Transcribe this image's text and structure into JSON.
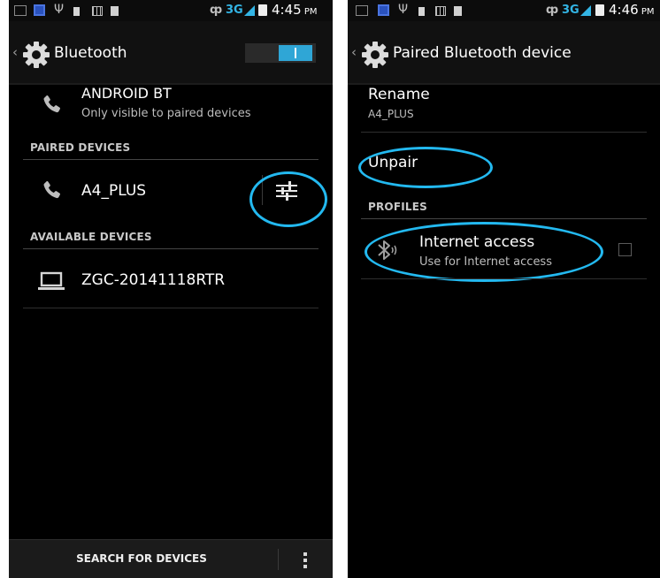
{
  "left_screen": {
    "status_bar": {
      "time": "4:45",
      "ampm": "PM",
      "network": "3G",
      "icons": [
        "notification-box-icon",
        "sim-icon",
        "usb-icon",
        "bag-icon",
        "grid-icon",
        "block-icon",
        "bluetooth-icon",
        "signal-icon",
        "battery-icon"
      ]
    },
    "action_bar": {
      "back_glyph": "‹",
      "icon": "settings-gear-icon",
      "title": "Bluetooth",
      "toggle_on": true
    },
    "device": {
      "name": "ANDROID BT",
      "subtitle": "Only visible to paired devices",
      "icon": "phone-icon"
    },
    "paired_section": {
      "header": "PAIRED DEVICES",
      "devices": [
        {
          "name": "A4_PLUS",
          "icon": "phone-icon",
          "settings_icon": "tune-settings-icon"
        }
      ]
    },
    "available_section": {
      "header": "AVAILABLE DEVICES",
      "devices": [
        {
          "name": "ZGC-20141118RTR",
          "icon": "laptop-icon"
        }
      ]
    },
    "bottom_bar": {
      "search_label": "SEARCH FOR DEVICES",
      "overflow_icon": "overflow-menu-icon"
    }
  },
  "right_screen": {
    "status_bar": {
      "time": "4:46",
      "ampm": "PM",
      "network": "3G"
    },
    "action_bar": {
      "back_glyph": "‹",
      "icon": "settings-gear-icon",
      "title": "Paired Bluetooth device"
    },
    "rename": {
      "label": "Rename",
      "value": "A4_PLUS"
    },
    "unpair": {
      "label": "Unpair"
    },
    "profiles_section": {
      "header": "PROFILES"
    },
    "profile": {
      "title": "Internet access",
      "subtitle": "Use for Internet access",
      "icon": "bluetooth-audio-icon",
      "checked": false
    }
  },
  "colors": {
    "accent": "#33b5e5",
    "highlight_ring": "#23b9f0",
    "background": "#000000"
  }
}
